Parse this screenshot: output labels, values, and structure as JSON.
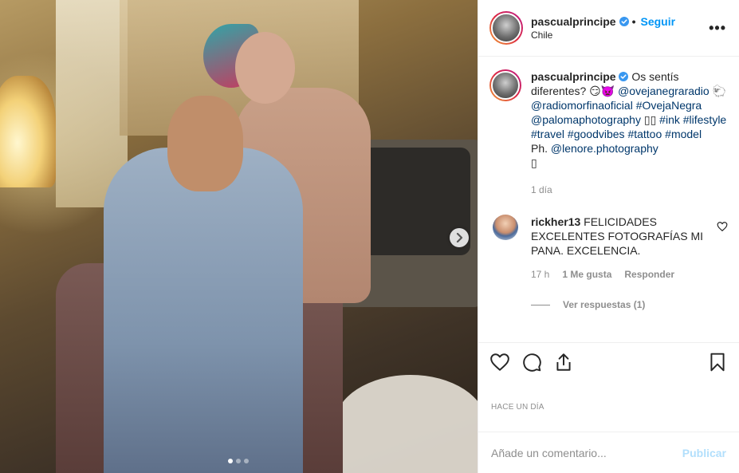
{
  "post": {
    "image_alt": "",
    "carousel": {
      "total": 3,
      "active": 0
    }
  },
  "header": {
    "username": "pascualprincipe",
    "separator": "•",
    "follow_label": "Seguir",
    "location": "Chile",
    "more_label": "•••"
  },
  "caption": {
    "username": "pascualprincipe",
    "text_parts": [
      {
        "type": "text",
        "value": "Os sentís diferentes? 😏👿 "
      },
      {
        "type": "link",
        "value": "@ovejanegraradio"
      },
      {
        "type": "text",
        "value": " 🐑 "
      },
      {
        "type": "link",
        "value": "@radiomorfinaoficial"
      },
      {
        "type": "text",
        "value": " "
      },
      {
        "type": "link",
        "value": "#OvejaNegra"
      },
      {
        "type": "text",
        "value": " "
      },
      {
        "type": "link",
        "value": "@palomaphotography"
      },
      {
        "type": "text",
        "value": " ▯▯  "
      },
      {
        "type": "link",
        "value": "#ink"
      },
      {
        "type": "text",
        "value": " "
      },
      {
        "type": "link",
        "value": "#lifestyle"
      },
      {
        "type": "text",
        "value": " "
      },
      {
        "type": "link",
        "value": "#travel"
      },
      {
        "type": "text",
        "value": " "
      },
      {
        "type": "link",
        "value": "#goodvibes"
      },
      {
        "type": "text",
        "value": " "
      },
      {
        "type": "link",
        "value": "#tattoo"
      },
      {
        "type": "text",
        "value": " "
      },
      {
        "type": "link",
        "value": "#model"
      },
      {
        "type": "text",
        "value": "\nPh. "
      },
      {
        "type": "link",
        "value": "@lenore.photography"
      },
      {
        "type": "text",
        "value": "\n▯"
      }
    ],
    "time": "1 día"
  },
  "comments": [
    {
      "username": "rickher13",
      "text": "FELICIDADES EXCELENTES FOTOGRAFÍAS MI PANA. EXCELENCIA.",
      "time": "17 h",
      "likes": "1 Me gusta",
      "reply_label": "Responder",
      "view_replies": "Ver respuestas (1)"
    }
  ],
  "footer": {
    "posted_ago": "HACE UN DÍA",
    "comment_placeholder": "Añade un comentario...",
    "publish_label": "Publicar"
  },
  "colors": {
    "accent": "#0095f6",
    "link": "#00376b",
    "muted": "#8e8e8e",
    "publish_disabled": "#b2dffc"
  },
  "icons": [
    "verified-badge-icon",
    "heart-icon",
    "comment-icon",
    "share-icon",
    "bookmark-icon",
    "chevron-right-icon",
    "more-icon"
  ]
}
